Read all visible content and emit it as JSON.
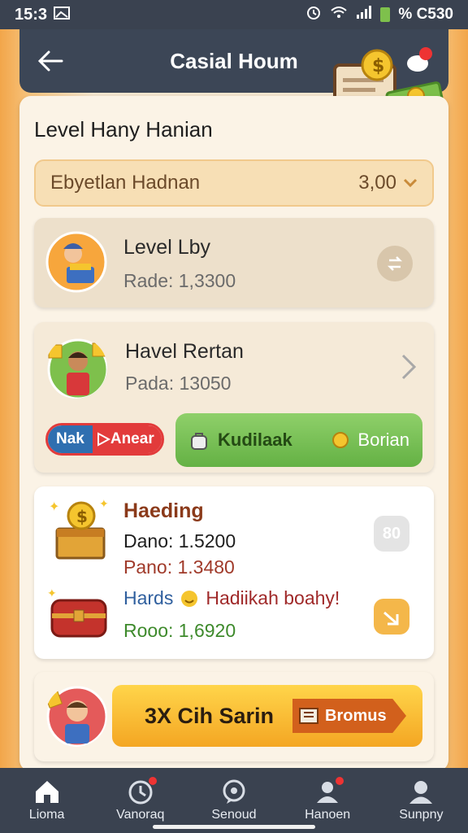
{
  "status_bar": {
    "time": "15:3",
    "right_text": "% C530"
  },
  "app_bar": {
    "title": "Casial Houm"
  },
  "section_title": "Level Hany Hanian",
  "selector": {
    "label": "Ebyetlan Hadnan",
    "value": "3,00"
  },
  "cards": {
    "level": {
      "title": "Level Lby",
      "subtitle": "Rade: 1,3300"
    },
    "havel": {
      "title": "Havel Rertan",
      "subtitle": "Pada: 13050",
      "pill_left": "Nak",
      "pill_right": "Anear",
      "green_left": "Kudilaak",
      "green_right": "Borian"
    },
    "haeding": {
      "title": "Haeding",
      "line1": "Dano: 1.5200",
      "line2": "Pano: 1.3480",
      "badge": "80",
      "hadis_label": "Hards",
      "hadis_text": "Hadiikah boahy!",
      "line3": "Rooo: 1,6920"
    },
    "bonus": {
      "text": "3X Cih Sarin",
      "tag": "Bromus"
    }
  },
  "bottom_nav": [
    {
      "label": "Lioma",
      "icon": "home-icon"
    },
    {
      "label": "Vanoraq",
      "icon": "clock-icon"
    },
    {
      "label": "Senoud",
      "icon": "chat-icon"
    },
    {
      "label": "Hanoen",
      "icon": "profile-alert-icon"
    },
    {
      "label": "Sunpny",
      "icon": "user-icon"
    }
  ],
  "colors": {
    "accent_orange": "#f4a623",
    "green": "#64b144",
    "nav_bg": "#3a4250"
  }
}
